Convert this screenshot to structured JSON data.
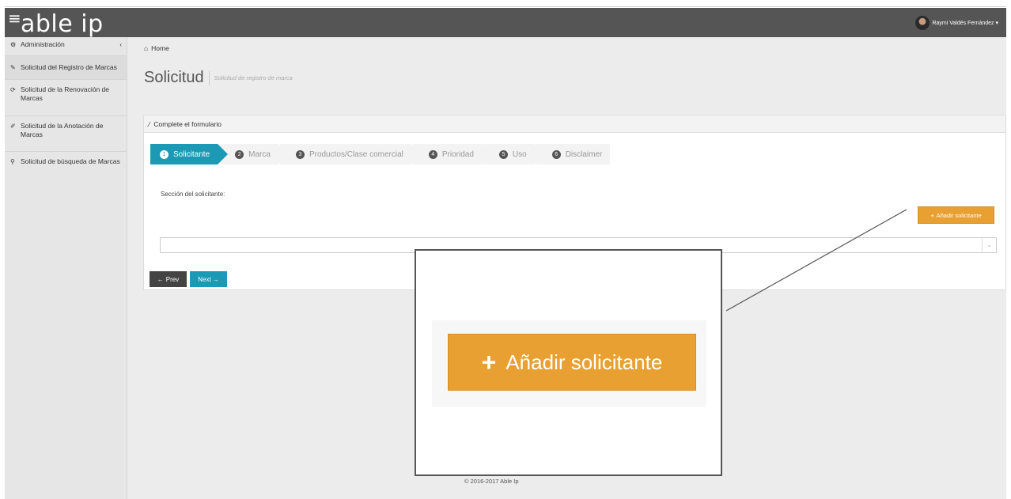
{
  "navbar": {
    "logo": "able ip",
    "user_name": "Raymi Valdés Fernández ▾"
  },
  "sidebar": {
    "admin_label": "Administración",
    "items": [
      {
        "label": "Solicitud del Registro de Marcas"
      },
      {
        "label": "Solicitud de la Renovación de Marcas"
      },
      {
        "label": "Solicitud de la Anotación de Marcas"
      },
      {
        "label": "Solicitud de búsqueda de Marcas"
      }
    ]
  },
  "breadcrumb": {
    "home": "Home"
  },
  "page": {
    "title": "Solicitud",
    "subtitle": "Solicitud de registro de marca"
  },
  "panel": {
    "heading": "Complete el formulario"
  },
  "steps": [
    {
      "num": "1",
      "label": "Solicitante"
    },
    {
      "num": "2",
      "label": "Marca"
    },
    {
      "num": "3",
      "label": "Productos/Clase comercial"
    },
    {
      "num": "4",
      "label": "Prioridad"
    },
    {
      "num": "5",
      "label": "Uso"
    },
    {
      "num": "6",
      "label": "Disclaimer"
    }
  ],
  "form": {
    "section_label": "Sección del solicitante:",
    "add_button": "Añadir solicitante",
    "select_value": "",
    "prev": "Prev",
    "next": "Next"
  },
  "footer": {
    "text": "© 2016-2017 Able Ip"
  },
  "zoom": {
    "label": "Añadir solicitante"
  },
  "colors": {
    "accent": "#1b99b5",
    "orange": "#e8a032",
    "navbar": "#555555"
  }
}
